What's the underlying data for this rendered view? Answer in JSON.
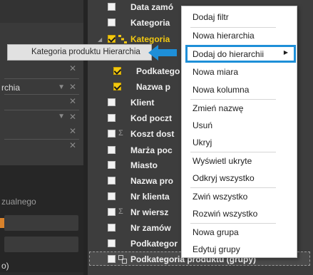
{
  "left_pane": {
    "visible_text_1": "rchia",
    "visible_text_2": "zualnego",
    "visible_text_3": "o)"
  },
  "field_list": {
    "rows": [
      {
        "label": "Data zamó",
        "checked": false
      },
      {
        "label": "Kategoria",
        "checked": false
      },
      {
        "label": "Kategoria",
        "checked": true,
        "hierarchy": true
      },
      {
        "label": "Podkatego",
        "checked": true
      },
      {
        "label": "Nazwa p",
        "checked": true
      },
      {
        "label": "Klient",
        "checked": false
      },
      {
        "label": "Kod poczt",
        "checked": false
      },
      {
        "label": "Koszt dost",
        "checked": false,
        "sigma": true
      },
      {
        "label": "Marża poc",
        "checked": false
      },
      {
        "label": "Miasto",
        "checked": false
      },
      {
        "label": "Nazwa pro",
        "checked": false
      },
      {
        "label": "Nr klienta",
        "checked": false
      },
      {
        "label": "Nr wiersz",
        "checked": false,
        "sigma": true
      },
      {
        "label": "Nr zamów",
        "checked": false
      },
      {
        "label": "Podkategor",
        "checked": false
      },
      {
        "label": "Podkategoria produktu (grupy)",
        "checked": false
      }
    ]
  },
  "drag_chip": {
    "label": "Kategoria produktu Hierarchia"
  },
  "context_menu": {
    "items": [
      "Dodaj filtr",
      "Nowa hierarchia",
      "Dodaj do hierarchii",
      "Nowa miara",
      "Nowa kolumna",
      "Zmień nazwę",
      "Usuń",
      "Ukryj",
      "Wyświetl ukryte",
      "Odkryj wszystko",
      "Zwiń wszystko",
      "Rozwiń wszystko",
      "Nowa grupa",
      "Edytuj grupy"
    ]
  },
  "colors": {
    "accent_checkbox": "#f2c811",
    "highlight_border": "#1e8fd8",
    "arrow": "#1e8fd8"
  }
}
